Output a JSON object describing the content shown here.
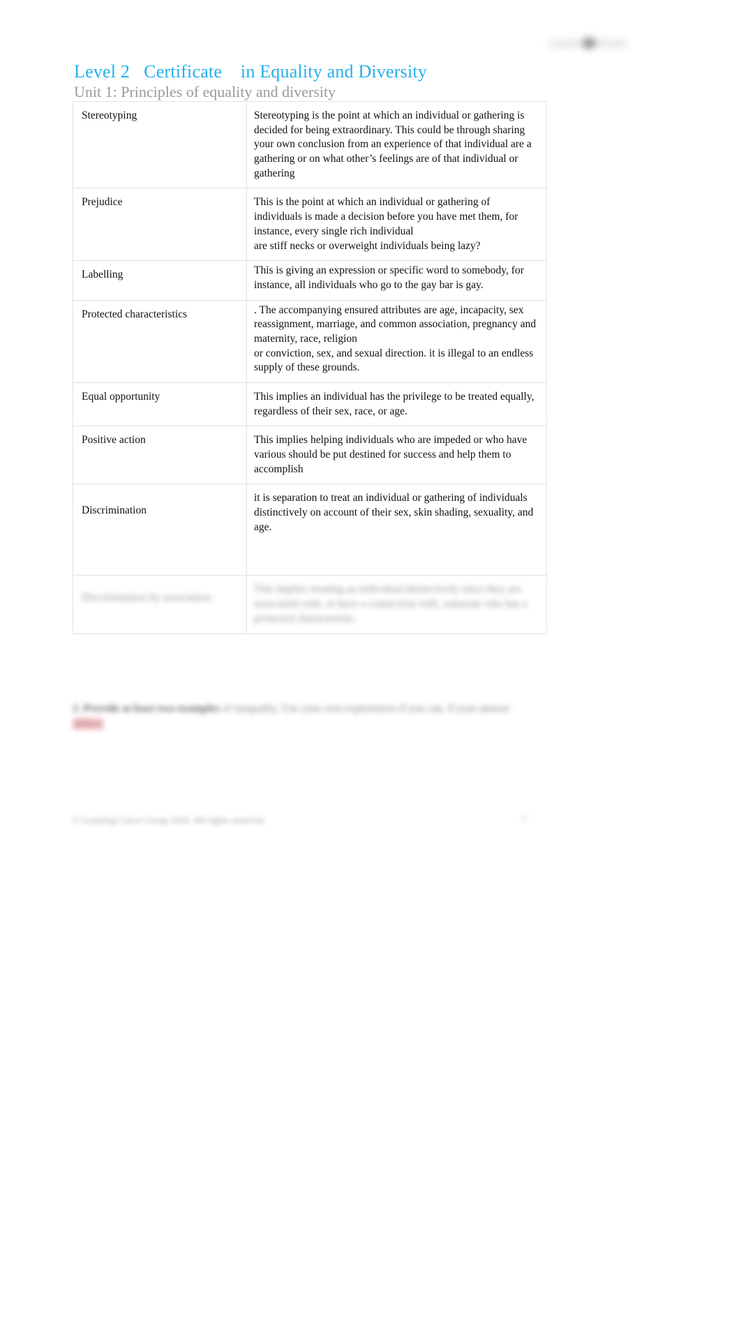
{
  "document": {
    "title": "Level 2   Certificate    in Equality and Diversity",
    "subtitle": "Unit 1: Principles of equality and diversity",
    "logo": {
      "wordmark": "Learn    Direct",
      "dot_icon": "circle-dot-icon"
    },
    "title_color": "#23b0ec",
    "subtitle_color": "#9a9a9a"
  },
  "table": {
    "rows": [
      {
        "term": "Stereotyping",
        "definition": "Stereotyping is the point at which an individual or gathering is decided for being extraordinary. This could be through sharing your own conclusion from an experience of that individual are a gathering or on what other’s feelings are of that individual or gathering"
      },
      {
        "term": "Prejudice",
        "definition": "This is the point at which an individual or gathering of individuals is made a decision before you have met them, for instance, every single rich individual\nare stiff necks or overweight individuals being lazy?"
      },
      {
        "term": "Labelling",
        "definition": "This is giving an expression or specific word to somebody, for instance, all individuals who go to the gay bar is gay."
      },
      {
        "term": "Protected characteristics",
        "definition": ". The accompanying ensured attributes are age, incapacity, sex reassignment, marriage, and common association, pregnancy and maternity, race, religion\nor conviction, sex, and sexual direction. it is illegal to an endless supply of these grounds."
      },
      {
        "term": "Equal opportunity",
        "definition": " This implies an individual has the privilege to be treated equally, regardless of their sex, race, or age."
      },
      {
        "term": "Positive action",
        "definition": "This implies helping individuals who are impeded or who have various should be put destined for success and help them to accomplish"
      },
      {
        "term": "Discrimination",
        "definition": "it is separation to treat an individual or gathering of individuals distinctively on account of their sex, skin shading, sexuality, and age."
      },
      {
        "term": "Discrimination by association",
        "definition": "This implies treating an individual distinctively since they are associated with, or have a connection with, someone who has a protected characteristic.",
        "blurred": true
      }
    ]
  },
  "after_table": {
    "task_label": "2. Provide at least two examples",
    "task_text": " of inequality. Use your own experiences if you can, if your answer ",
    "task_tail": "differs",
    "highlight_color": "#ffb3b8"
  },
  "footer": {
    "copyright": "© Learning Curve Group 2020. All rights reserved.",
    "page_number": "2"
  }
}
